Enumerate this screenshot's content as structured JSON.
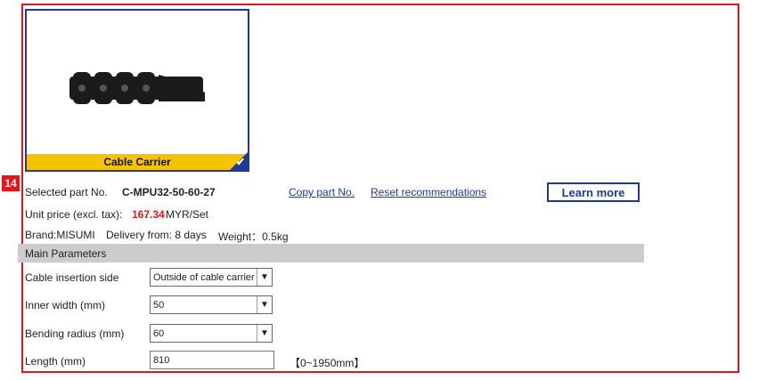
{
  "badge": "14",
  "product": {
    "card_label": "Cable Carrier"
  },
  "info": {
    "selected_label": "Selected part No.",
    "part_no": "C-MPU32-50-60-27",
    "copy_link": "Copy part No.",
    "reset_link": "Reset recommendations",
    "learn_more": "Learn more",
    "price_label": "Unit price (excl. tax):",
    "price_value": "167.34",
    "price_unit": "MYR/Set",
    "brand": "Brand:MISUMI",
    "delivery": "Delivery from: 8 days",
    "weight": "Weight：0.5kg"
  },
  "params": {
    "section_title": "Main Parameters",
    "rows": [
      {
        "label": "Cable insertion side",
        "value": "Outside of cable carrier"
      },
      {
        "label": "Inner width (mm)",
        "value": "50"
      },
      {
        "label": "Bending radius (mm)",
        "value": "60"
      },
      {
        "label": "Length (mm)",
        "value": "810",
        "range": "【0~1950mm】"
      }
    ]
  },
  "colors": {
    "accent_red": "#e8141c",
    "brand_blue": "#1f3a93",
    "label_yellow": "#f5c400"
  }
}
